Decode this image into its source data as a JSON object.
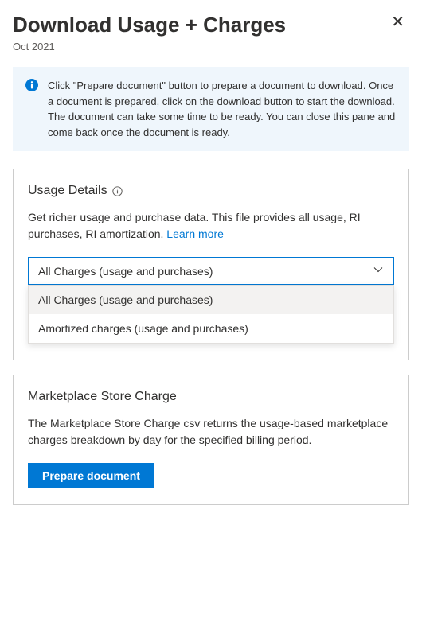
{
  "header": {
    "title": "Download Usage + Charges",
    "subtitle": "Oct 2021",
    "close_symbol": "✕"
  },
  "info_banner": {
    "text": "Click \"Prepare document\" button to prepare a document to download. Once a document is prepared, click on the download button to start the download. The document can take some time to be ready. You can close this pane and come back once the document is ready."
  },
  "usage_details": {
    "title": "Usage Details",
    "description_prefix": "Get richer usage and purchase data. This file provides all usage, RI purchases, RI amortization. ",
    "learn_more_label": "Learn more",
    "dropdown": {
      "selected": "All Charges (usage and purchases)",
      "options": [
        "All Charges (usage and purchases)",
        "Amortized charges (usage and purchases)"
      ]
    }
  },
  "marketplace": {
    "title": "Marketplace Store Charge",
    "description": "The Marketplace Store Charge csv returns the usage-based marketplace charges breakdown by day for the specified billing period.",
    "button_label": "Prepare document"
  },
  "colors": {
    "primary": "#0078d4",
    "info_bg": "#eff6fc",
    "border": "#cccccc"
  }
}
